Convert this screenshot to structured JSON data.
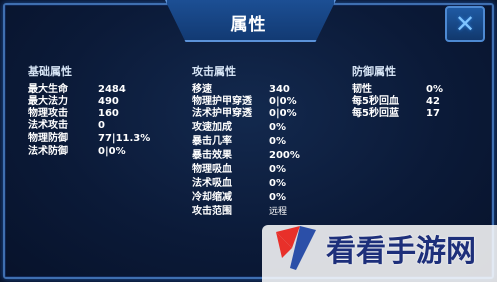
{
  "window": {
    "title": "属性",
    "close_icon": "close-x-icon"
  },
  "sections": {
    "basic": {
      "title": "基础属性",
      "stats": [
        {
          "label": "最大生命",
          "value": "2484"
        },
        {
          "label": "最大法力",
          "value": "490"
        },
        {
          "label": "物理攻击",
          "value": "160"
        },
        {
          "label": "法术攻击",
          "value": "0"
        },
        {
          "label": "物理防御",
          "value": "77|11.3%"
        },
        {
          "label": "法术防御",
          "value": "0|0%"
        }
      ]
    },
    "attack": {
      "title": "攻击属性",
      "stats": [
        {
          "label": "移速",
          "value": "340"
        },
        {
          "label": "物理护甲穿透",
          "value": "0|0%"
        },
        {
          "label": "法术护甲穿透",
          "value": "0|0%"
        },
        {
          "label": "攻速加成",
          "value": "0%"
        },
        {
          "label": "暴击几率",
          "value": "0%"
        },
        {
          "label": "暴击效果",
          "value": "200%"
        },
        {
          "label": "物理吸血",
          "value": "0%"
        },
        {
          "label": "法术吸血",
          "value": "0%"
        },
        {
          "label": "冷却缩减",
          "value": "0%"
        },
        {
          "label": "攻击范围",
          "value": "远程"
        }
      ]
    },
    "defense": {
      "title": "防御属性",
      "stats": [
        {
          "label": "韧性",
          "value": "0%"
        },
        {
          "label": "每5秒回血",
          "value": "42"
        },
        {
          "label": "每5秒回蓝",
          "value": "17"
        }
      ]
    }
  },
  "watermark": {
    "text": "看看手游网"
  },
  "colors": {
    "panel_bg": "#0b1a38",
    "border": "#3f6fb0",
    "text": "#ffffff",
    "watermark_text": "#1d2f7a",
    "logo_red": "#e8302a",
    "logo_blue": "#2b4fa8"
  }
}
